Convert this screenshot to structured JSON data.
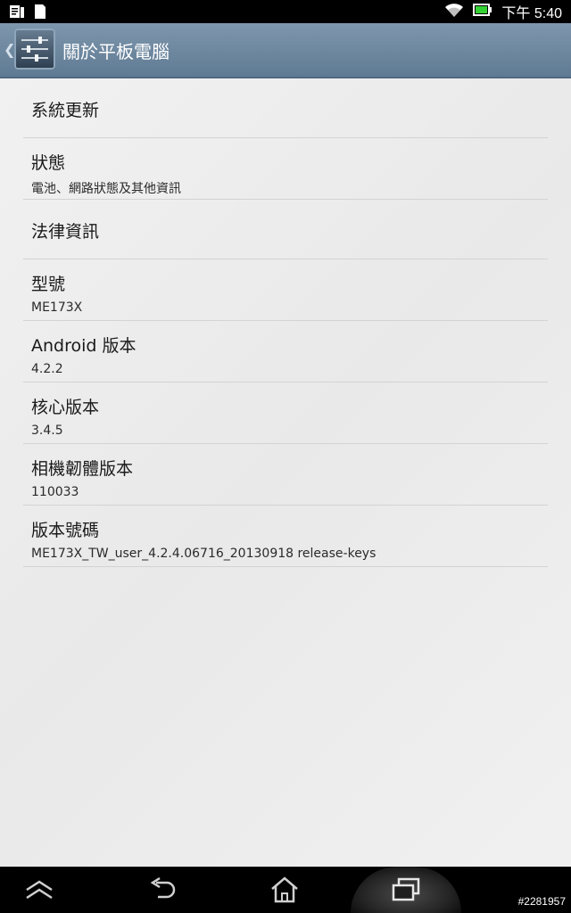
{
  "status_bar": {
    "time": "下午 5:40",
    "icons": [
      "clipboard-battery-icon",
      "sd-card-icon",
      "wifi-icon",
      "battery-icon"
    ]
  },
  "action_bar": {
    "title": "關於平板電腦",
    "icon": "settings-sliders-icon"
  },
  "items": [
    {
      "title": "系統更新"
    },
    {
      "title": "狀態",
      "subtitle": "電池、網路狀態及其他資訊"
    },
    {
      "title": "法律資訊"
    },
    {
      "title": "型號",
      "subtitle": "ME173X"
    },
    {
      "title": "Android 版本",
      "subtitle": "4.2.2"
    },
    {
      "title": "核心版本",
      "subtitle": "3.4.5"
    },
    {
      "title": "相機韌體版本",
      "subtitle": "110033"
    },
    {
      "title": "版本號碼",
      "subtitle": "ME173X_TW_user_4.2.4.06716_20130918 release-keys"
    }
  ],
  "nav_bar": {
    "buttons": [
      "up-chevron-icon",
      "back-icon",
      "home-icon",
      "recents-icon"
    ]
  },
  "watermark": "#2281957",
  "colors": {
    "action_bar": "#6f889f",
    "background": "#eeeeee",
    "divider": "#d3d3d3"
  }
}
